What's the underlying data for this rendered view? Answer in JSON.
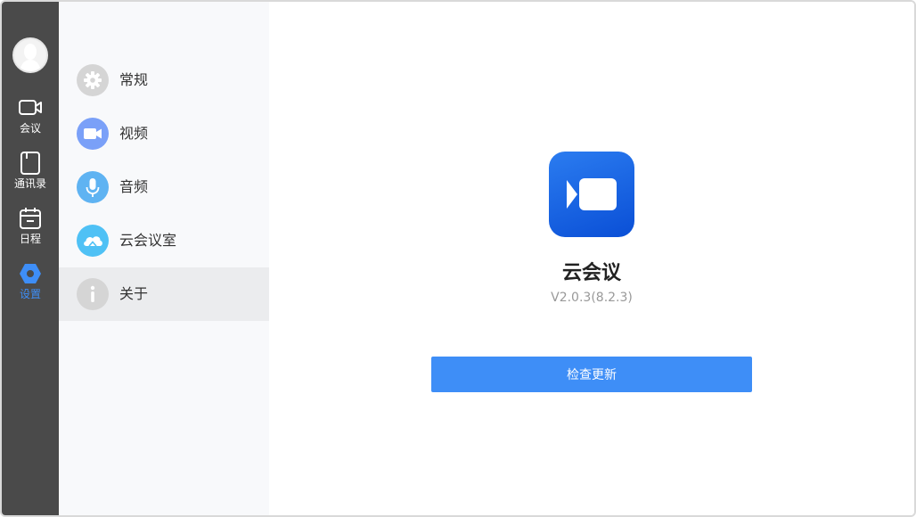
{
  "rail": {
    "items": [
      {
        "label": "会议",
        "icon": "video-camera-icon"
      },
      {
        "label": "通讯录",
        "icon": "contacts-book-icon"
      },
      {
        "label": "日程",
        "icon": "calendar-icon"
      },
      {
        "label": "设置",
        "icon": "settings-hexagon-icon"
      }
    ],
    "active_index": 3
  },
  "panel": {
    "items": [
      {
        "label": "常规",
        "icon": "gear-icon",
        "color": "#d5d5d5"
      },
      {
        "label": "视频",
        "icon": "video-icon",
        "color": "#7aa0f8"
      },
      {
        "label": "音频",
        "icon": "microphone-icon",
        "color": "#5fb3f2"
      },
      {
        "label": "云会议室",
        "icon": "cloud-icon",
        "color": "#4fc1f5"
      },
      {
        "label": "关于",
        "icon": "info-icon",
        "color": "#d5d5d5"
      }
    ],
    "active_index": 4
  },
  "about": {
    "app_name": "云会议",
    "version": "V2.0.3(8.2.3)",
    "check_update_label": "检查更新"
  },
  "colors": {
    "accent": "#3e8ef7",
    "rail_bg": "#4a4a4a",
    "panel_bg": "#f8f9fb",
    "panel_active_bg": "#ebecee"
  }
}
